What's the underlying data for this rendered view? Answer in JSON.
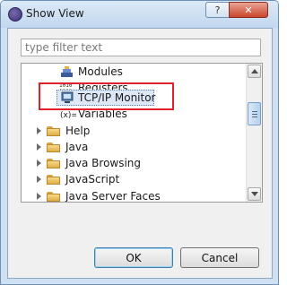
{
  "window": {
    "title": "Show View",
    "title_icon": "eclipse-icon",
    "help_glyph": "?",
    "close_glyph": "✕"
  },
  "filter": {
    "placeholder": "type filter text",
    "value": ""
  },
  "tree": {
    "items": [
      {
        "label": "Modules",
        "icon": "modules-icon",
        "expandable": false
      },
      {
        "label": "Registers",
        "icon": "registers-icon",
        "icon_text": "1010\n0101",
        "expandable": false
      },
      {
        "label": "TCP/IP Monitor",
        "icon": "monitor-icon",
        "expandable": false,
        "selected": true
      },
      {
        "label": "Variables",
        "icon": "variables-icon",
        "icon_text": "(x)=",
        "expandable": false
      },
      {
        "label": "Help",
        "icon": "folder-icon",
        "expandable": true
      },
      {
        "label": "Java",
        "icon": "folder-icon",
        "expandable": true
      },
      {
        "label": "Java Browsing",
        "icon": "folder-icon",
        "expandable": true
      },
      {
        "label": "JavaScript",
        "icon": "folder-icon",
        "expandable": true
      },
      {
        "label": "Java Server Faces",
        "icon": "folder-icon",
        "expandable": true
      }
    ]
  },
  "buttons": {
    "ok": "OK",
    "cancel": "Cancel"
  },
  "colors": {
    "highlight_box": "#e0202a",
    "selection_bg": "#dde8f6",
    "window_frame": "#cfe0f3"
  }
}
